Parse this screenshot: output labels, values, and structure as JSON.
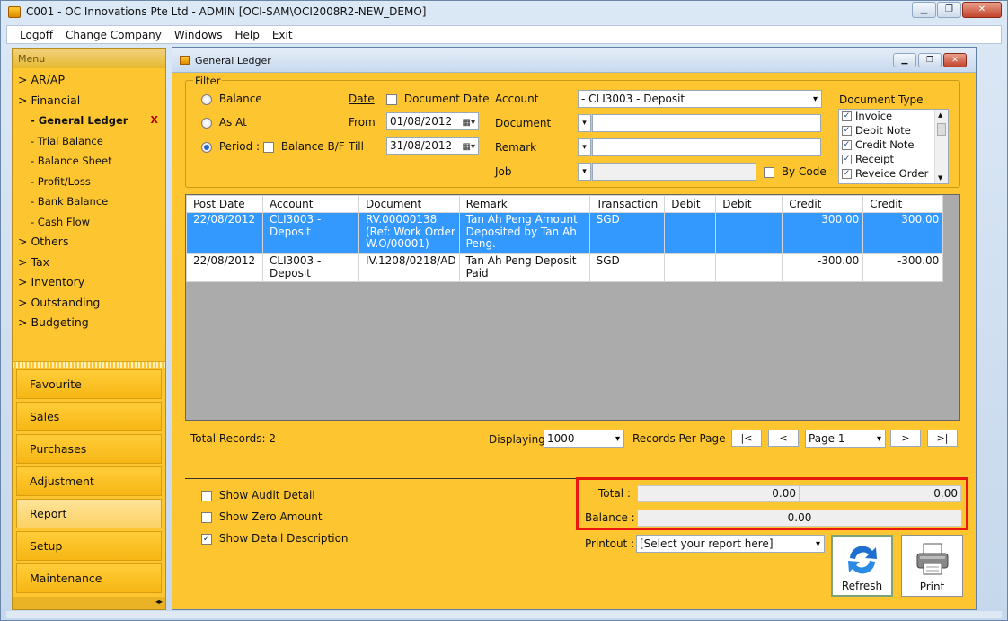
{
  "window": {
    "title": "C001 - OC Innovations Pte Ltd - ADMIN [OCI-SAM\\OCI2008R2-NEW_DEMO]"
  },
  "menubar": [
    "Logoff",
    "Change Company",
    "Windows",
    "Help",
    "Exit"
  ],
  "left_panel": {
    "header": "Menu",
    "tree": [
      {
        "label": "> AR/AP",
        "level": 0
      },
      {
        "label": "> Financial",
        "level": 0
      },
      {
        "label": "- General Ledger",
        "level": 1,
        "active": true,
        "close_mark": "X"
      },
      {
        "label": "- Trial Balance",
        "level": 1
      },
      {
        "label": "- Balance Sheet",
        "level": 1
      },
      {
        "label": "- Profit/Loss",
        "level": 1
      },
      {
        "label": "- Bank Balance",
        "level": 1
      },
      {
        "label": "- Cash Flow",
        "level": 1
      },
      {
        "label": "> Others",
        "level": 0
      },
      {
        "label": "> Tax",
        "level": 0
      },
      {
        "label": "> Inventory",
        "level": 0
      },
      {
        "label": "> Outstanding",
        "level": 0
      },
      {
        "label": "> Budgeting",
        "level": 0
      }
    ],
    "nav_buttons": [
      "Favourite",
      "Sales",
      "Purchases",
      "Adjustment",
      "Report",
      "Setup",
      "Maintenance"
    ],
    "selected_nav": "Report",
    "footer_glyph": "◂▸"
  },
  "child": {
    "title": "General Ledger",
    "filter": {
      "legend": "Filter",
      "balance_label": "Balance",
      "as_at_label": "As At",
      "period_label": "Period :",
      "balance_bf_label": "Balance B/F",
      "date_link": "Date",
      "document_date_label": "Document Date",
      "from_label": "From",
      "from_value": "01/08/2012",
      "till_label": "Till",
      "till_value": "31/08/2012",
      "account_label": "Account",
      "account_value": "- CLI3003 - Deposit",
      "document_label": "Document",
      "remark_label": "Remark",
      "job_label": "Job",
      "by_code_label": "By Code",
      "document_type_label": "Document Type",
      "document_types": [
        "Invoice",
        "Debit Note",
        "Credit Note",
        "Receipt",
        "Reveice Order"
      ]
    },
    "grid": {
      "columns": [
        "Post Date",
        "Account",
        "Document",
        "Remark",
        "Transaction",
        "Debit",
        "Debit",
        "Credit",
        "Credit"
      ],
      "rows": [
        {
          "post_date": "22/08/2012",
          "account": "CLI3003 - Deposit",
          "document": "RV.00000138 (Ref: Work Order W.O/00001)",
          "remark": "Tan Ah Peng Amount Deposited by Tan Ah Peng.",
          "transaction": "SGD",
          "debit1": "",
          "debit2": "",
          "credit1": "300.00",
          "credit2": "300.00",
          "selected": true
        },
        {
          "post_date": "22/08/2012",
          "account": "CLI3003 - Deposit",
          "document": "IV.1208/0218/AD",
          "remark": "Tan Ah Peng Deposit Paid",
          "transaction": "SGD",
          "debit1": "",
          "debit2": "",
          "credit1": "-300.00",
          "credit2": "-300.00",
          "selected": false
        }
      ]
    },
    "pager": {
      "total_records": "Total Records: 2",
      "displaying_label": "Displaying",
      "per_page_value": "1000",
      "records_per_page_label": "Records Per Page",
      "first": "|<",
      "prev": "<",
      "page_value": "Page 1",
      "next": ">",
      "last": ">|"
    },
    "options": {
      "show_audit_detail": "Show Audit Detail",
      "show_zero_amount": "Show Zero Amount",
      "show_detail_description": "Show Detail Description"
    },
    "totals": {
      "total_label": "Total :",
      "total_debit": "0.00",
      "total_credit": "0.00",
      "balance_label": "Balance :",
      "balance_value": "0.00"
    },
    "printout": {
      "label": "Printout :",
      "value": "[Select your report here]"
    },
    "buttons": {
      "refresh": "Refresh",
      "print": "Print"
    }
  }
}
